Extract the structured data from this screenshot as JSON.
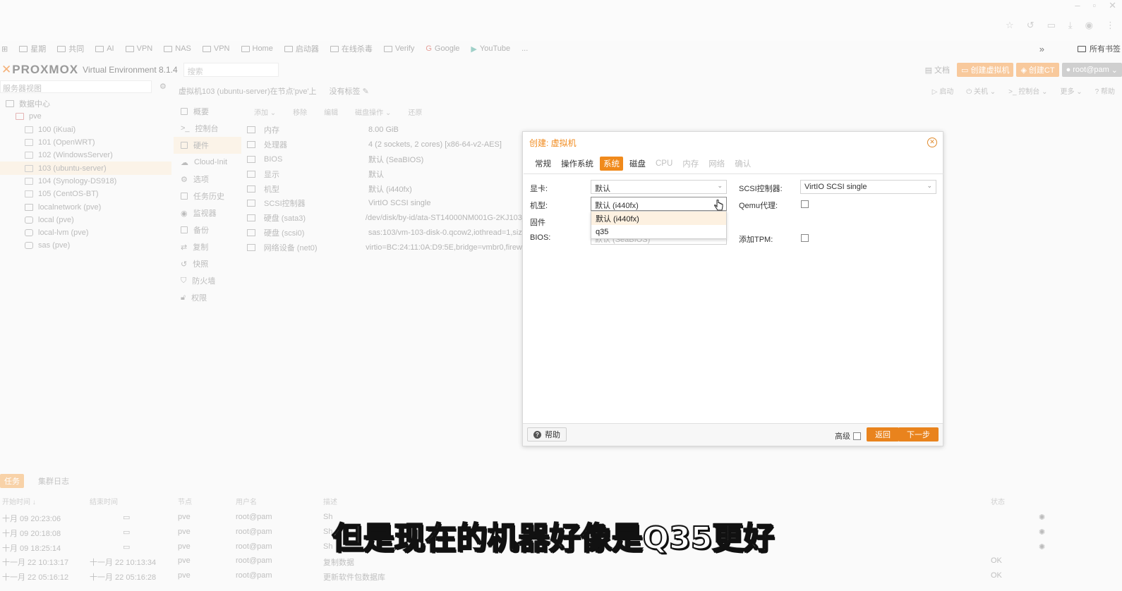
{
  "bookmarks": {
    "items": [
      "星期",
      "共同",
      "AI",
      "VPN",
      "Home",
      "启动器",
      "在线杀毒",
      "Verify",
      "Google",
      "YouTube",
      "...",
      "VPN",
      "NAS"
    ],
    "all_bookmarks": "所有书签",
    "more": "»"
  },
  "header": {
    "logo": "PROXMOX",
    "version": "Virtual Environment 8.1.4",
    "search_placeholder": "搜索",
    "docs": "文档",
    "create_vm": "创建虚拟机",
    "create_ct": "创建CT",
    "user": "root@pam"
  },
  "tree": {
    "view": "服务器视图",
    "datacenter": "数据中心",
    "node": "pve",
    "items": [
      {
        "label": "100 (iKuai)",
        "type": "vm"
      },
      {
        "label": "101 (OpenWRT)",
        "type": "vm"
      },
      {
        "label": "102 (WindowsServer)",
        "type": "vm"
      },
      {
        "label": "103 (ubuntu-server)",
        "type": "vm",
        "selected": true
      },
      {
        "label": "104 (Synology-DS918)",
        "type": "vm"
      },
      {
        "label": "105 (CentOS-BT)",
        "type": "vm"
      },
      {
        "label": "localnetwork (pve)",
        "type": "net"
      },
      {
        "label": "local (pve)",
        "type": "storage"
      },
      {
        "label": "local-lvm (pve)",
        "type": "storage"
      },
      {
        "label": "sas (pve)",
        "type": "storage"
      }
    ]
  },
  "vmbar": {
    "crumb": "虚拟机103 (ubuntu-server)在节点'pve'上",
    "tags": "没有标签",
    "start": "启动",
    "shutdown": "关机",
    "console": "控制台",
    "more": "更多",
    "help": "帮助"
  },
  "submenu": [
    "概要",
    "控制台",
    "硬件",
    "Cloud-Init",
    "选项",
    "任务历史",
    "监视器",
    "备份",
    "复制",
    "快照",
    "防火墙",
    "权限"
  ],
  "toolbar": [
    "添加",
    "移除",
    "编辑",
    "磁盘操作",
    "还原"
  ],
  "hardware": [
    {
      "k": "内存",
      "v": "8.00 GiB"
    },
    {
      "k": "处理器",
      "v": "4 (2 sockets, 2 cores) [x86-64-v2-AES]"
    },
    {
      "k": "BIOS",
      "v": "默认 (SeaBIOS)"
    },
    {
      "k": "显示",
      "v": "默认"
    },
    {
      "k": "机型",
      "v": "默认 (i440fx)"
    },
    {
      "k": "SCSI控制器",
      "v": "VirtIO SCSI single"
    },
    {
      "k": "硬盘 (sata3)",
      "v": "/dev/disk/by-id/ata-ST14000NM001G-2KJ103_"
    },
    {
      "k": "硬盘 (scsi0)",
      "v": "sas:103/vm-103-disk-0.qcow2,iothread=1,size"
    },
    {
      "k": "网络设备 (net0)",
      "v": "virtio=BC:24:11:0A:D9:5E,bridge=vmbr0,firewa"
    }
  ],
  "dialog": {
    "title": "创建: 虚拟机",
    "tabs": [
      {
        "label": "常规",
        "state": "normal"
      },
      {
        "label": "操作系统",
        "state": "normal"
      },
      {
        "label": "系统",
        "state": "active"
      },
      {
        "label": "磁盘",
        "state": "normal"
      },
      {
        "label": "CPU",
        "state": "dim"
      },
      {
        "label": "内存",
        "state": "dim"
      },
      {
        "label": "网络",
        "state": "dim"
      },
      {
        "label": "确认",
        "state": "dim"
      }
    ],
    "graphics_label": "显卡:",
    "graphics_value": "默认",
    "machine_label": "机型:",
    "machine_value": "默认 (i440fx)",
    "firmware_label": "固件",
    "bios_label": "BIOS:",
    "bios_value": "默认 (SeaBIOS)",
    "scsi_label": "SCSI控制器:",
    "scsi_value": "VirtIO SCSI single",
    "qemu_label": "Qemu代理:",
    "tpm_label": "添加TPM:",
    "dropdown_options": [
      "默认 (i440fx)",
      "q35"
    ],
    "help": "帮助",
    "advanced": "高级",
    "back": "返回",
    "next": "下一步"
  },
  "log": {
    "tabs": [
      "任务",
      "集群日志"
    ],
    "headers": [
      "开始时间 ↓",
      "结束时间",
      "节点",
      "用户名",
      "描述",
      "状态"
    ],
    "rows": [
      {
        "start": "十月 09 20:23:06",
        "end": "",
        "node": "pve",
        "user": "root@pam",
        "desc": "Sh",
        "status": "",
        "running": true
      },
      {
        "start": "十月 09 20:18:08",
        "end": "",
        "node": "pve",
        "user": "root@pam",
        "desc": "Sh",
        "status": "",
        "running": true
      },
      {
        "start": "十月 09 18:25:14",
        "end": "",
        "node": "pve",
        "user": "root@pam",
        "desc": "Sh",
        "status": "",
        "running": true
      },
      {
        "start": "十一月 22 10:13:17",
        "end": "十一月 22 10:13:34",
        "node": "pve",
        "user": "root@pam",
        "desc": "复制数据",
        "status": "OK",
        "running": false
      },
      {
        "start": "十一月 22 05:16:12",
        "end": "十一月 22 05:16:28",
        "node": "pve",
        "user": "root@pam",
        "desc": "更新软件包数据库",
        "status": "OK",
        "running": false
      }
    ]
  },
  "subtitle": "但是现在的机器好像是Q35更好"
}
